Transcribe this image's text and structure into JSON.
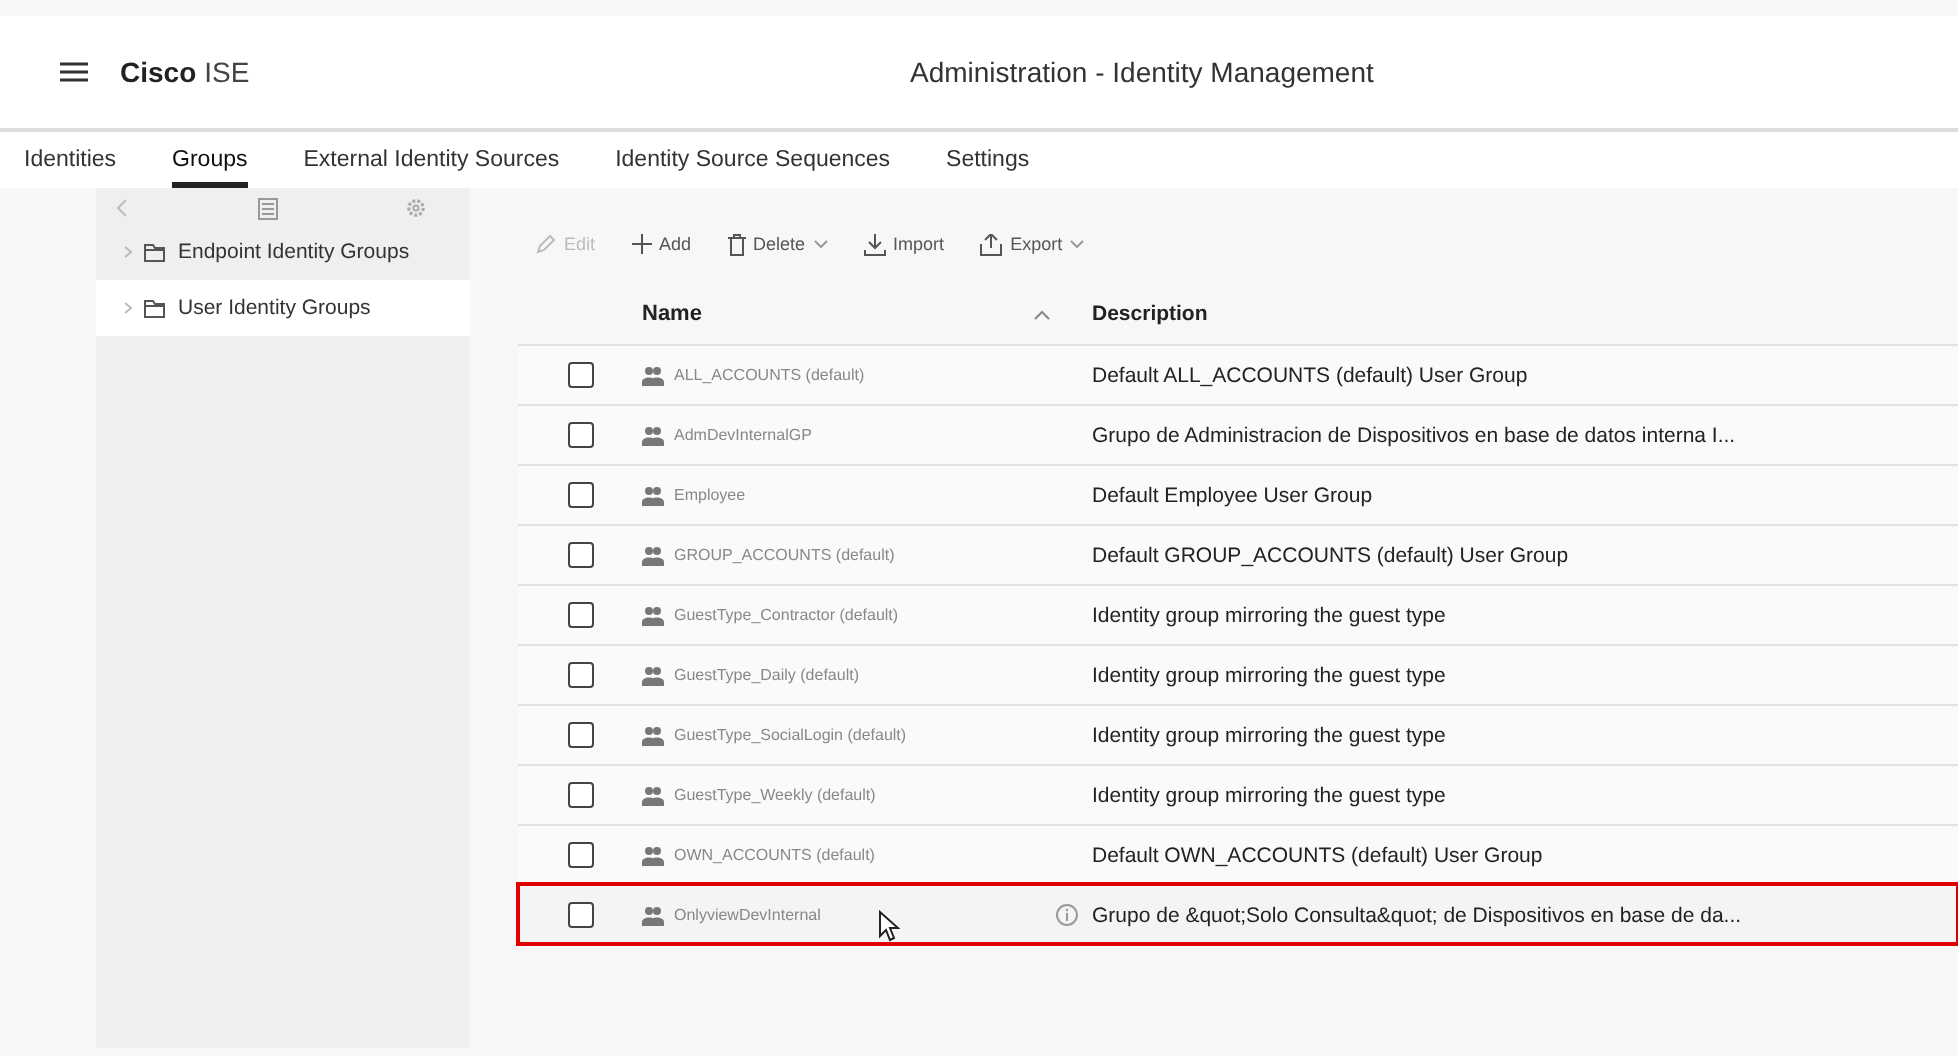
{
  "header": {
    "brand_bold": "Cisco",
    "brand_light": "ISE",
    "title": "Administration - Identity Management"
  },
  "tabs": [
    {
      "label": "Identities",
      "selected": false
    },
    {
      "label": "Groups",
      "selected": true
    },
    {
      "label": "External Identity Sources",
      "selected": false
    },
    {
      "label": "Identity Source Sequences",
      "selected": false
    },
    {
      "label": "Settings",
      "selected": false
    }
  ],
  "sidebar": {
    "items": [
      {
        "label": "Endpoint Identity Groups",
        "selected": false
      },
      {
        "label": "User Identity Groups",
        "selected": true
      }
    ]
  },
  "toolbar": [
    {
      "kind": "edit",
      "label": "Edit",
      "disabled": true,
      "dropdown": false
    },
    {
      "kind": "add",
      "label": "Add",
      "disabled": false,
      "dropdown": false
    },
    {
      "kind": "delete",
      "label": "Delete",
      "disabled": false,
      "dropdown": true
    },
    {
      "kind": "import",
      "label": "Import",
      "disabled": false,
      "dropdown": false
    },
    {
      "kind": "export",
      "label": "Export",
      "disabled": false,
      "dropdown": true
    }
  ],
  "table": {
    "columns": [
      "Name",
      "Description"
    ],
    "rows": [
      {
        "checked": false,
        "name": "ALL_ACCOUNTS (default)",
        "description": "Default ALL_ACCOUNTS (default) User Group",
        "info": false,
        "highlighted": false
      },
      {
        "checked": false,
        "name": "AdmDevInternalGP",
        "description": "Grupo de Administracion de Dispositivos en base de datos interna I...",
        "info": false,
        "highlighted": false
      },
      {
        "checked": false,
        "name": "Employee",
        "description": "Default Employee User Group",
        "info": false,
        "highlighted": false
      },
      {
        "checked": false,
        "name": "GROUP_ACCOUNTS (default)",
        "description": "Default GROUP_ACCOUNTS (default) User Group",
        "info": false,
        "highlighted": false
      },
      {
        "checked": false,
        "name": "GuestType_Contractor (default)",
        "description": "Identity group mirroring the guest type",
        "info": false,
        "highlighted": false
      },
      {
        "checked": false,
        "name": "GuestType_Daily (default)",
        "description": "Identity group mirroring the guest type",
        "info": false,
        "highlighted": false
      },
      {
        "checked": false,
        "name": "GuestType_SocialLogin (default)",
        "description": "Identity group mirroring the guest type",
        "info": false,
        "highlighted": false
      },
      {
        "checked": false,
        "name": "GuestType_Weekly (default)",
        "description": "Identity group mirroring the guest type",
        "info": false,
        "highlighted": false
      },
      {
        "checked": false,
        "name": "OWN_ACCOUNTS (default)",
        "description": "Default OWN_ACCOUNTS (default) User Group",
        "info": false,
        "highlighted": false
      },
      {
        "checked": false,
        "name": "OnlyviewDevInternal",
        "description": "Grupo de &quot;Solo Consulta&quot; de Dispositivos en base de da...",
        "info": true,
        "highlighted": true
      }
    ]
  }
}
